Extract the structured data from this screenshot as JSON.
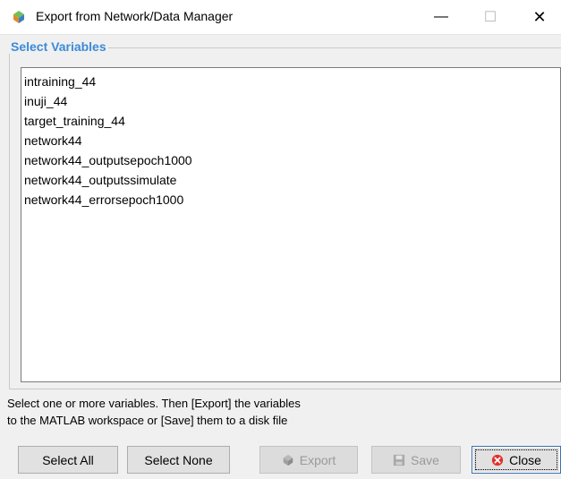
{
  "window": {
    "title": "Export from Network/Data Manager",
    "minimize_glyph": "—",
    "maximize_glyph": "☐",
    "close_glyph": "✕",
    "icon": "matlab-nn-icon"
  },
  "group": {
    "title": "Select Variables"
  },
  "variables": [
    "intraining_44",
    "inuji_44",
    "target_training_44",
    "network44",
    "network44_outputsepoch1000",
    "network44_outputssimulate",
    "network44_errorsepoch1000"
  ],
  "help": {
    "line1": "Select one or more variables. Then [Export] the variables",
    "line2": "to the MATLAB workspace or [Save] them to a disk file"
  },
  "buttons": {
    "select_all": "Select All",
    "select_none": "Select None",
    "export": "Export",
    "save": "Save",
    "close": "Close"
  },
  "colors": {
    "group_title": "#3b8ad9",
    "close_icon": "#e0322b"
  }
}
